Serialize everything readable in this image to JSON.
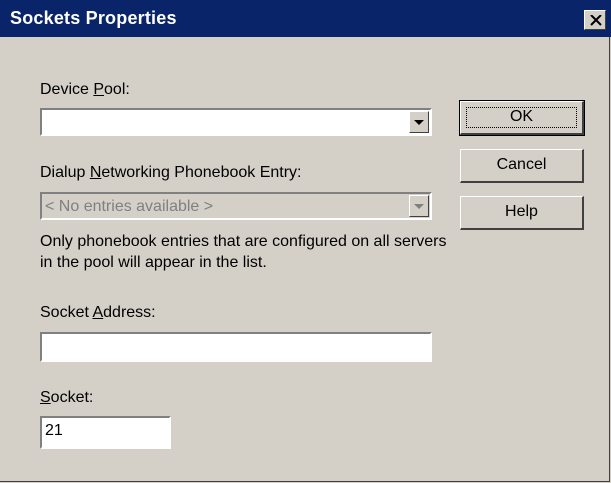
{
  "window": {
    "title": "Sockets Properties"
  },
  "device_pool": {
    "label_pre": "Device ",
    "label_key": "P",
    "label_post": "ool:",
    "value": ""
  },
  "dialup": {
    "label_pre": "Dialup ",
    "label_key": "N",
    "label_post": "etworking Phonebook Entry:",
    "value": "< No entries available >",
    "note": "Only phonebook entries that are configured on all servers in the pool will appear in the list."
  },
  "socket_address": {
    "label_pre": "Socket ",
    "label_key": "A",
    "label_post": "ddress:",
    "value": ""
  },
  "socket": {
    "label_pre": "",
    "label_key": "S",
    "label_post": "ocket:",
    "value": "21"
  },
  "buttons": {
    "ok": "OK",
    "cancel": "Cancel",
    "help": "Help"
  }
}
